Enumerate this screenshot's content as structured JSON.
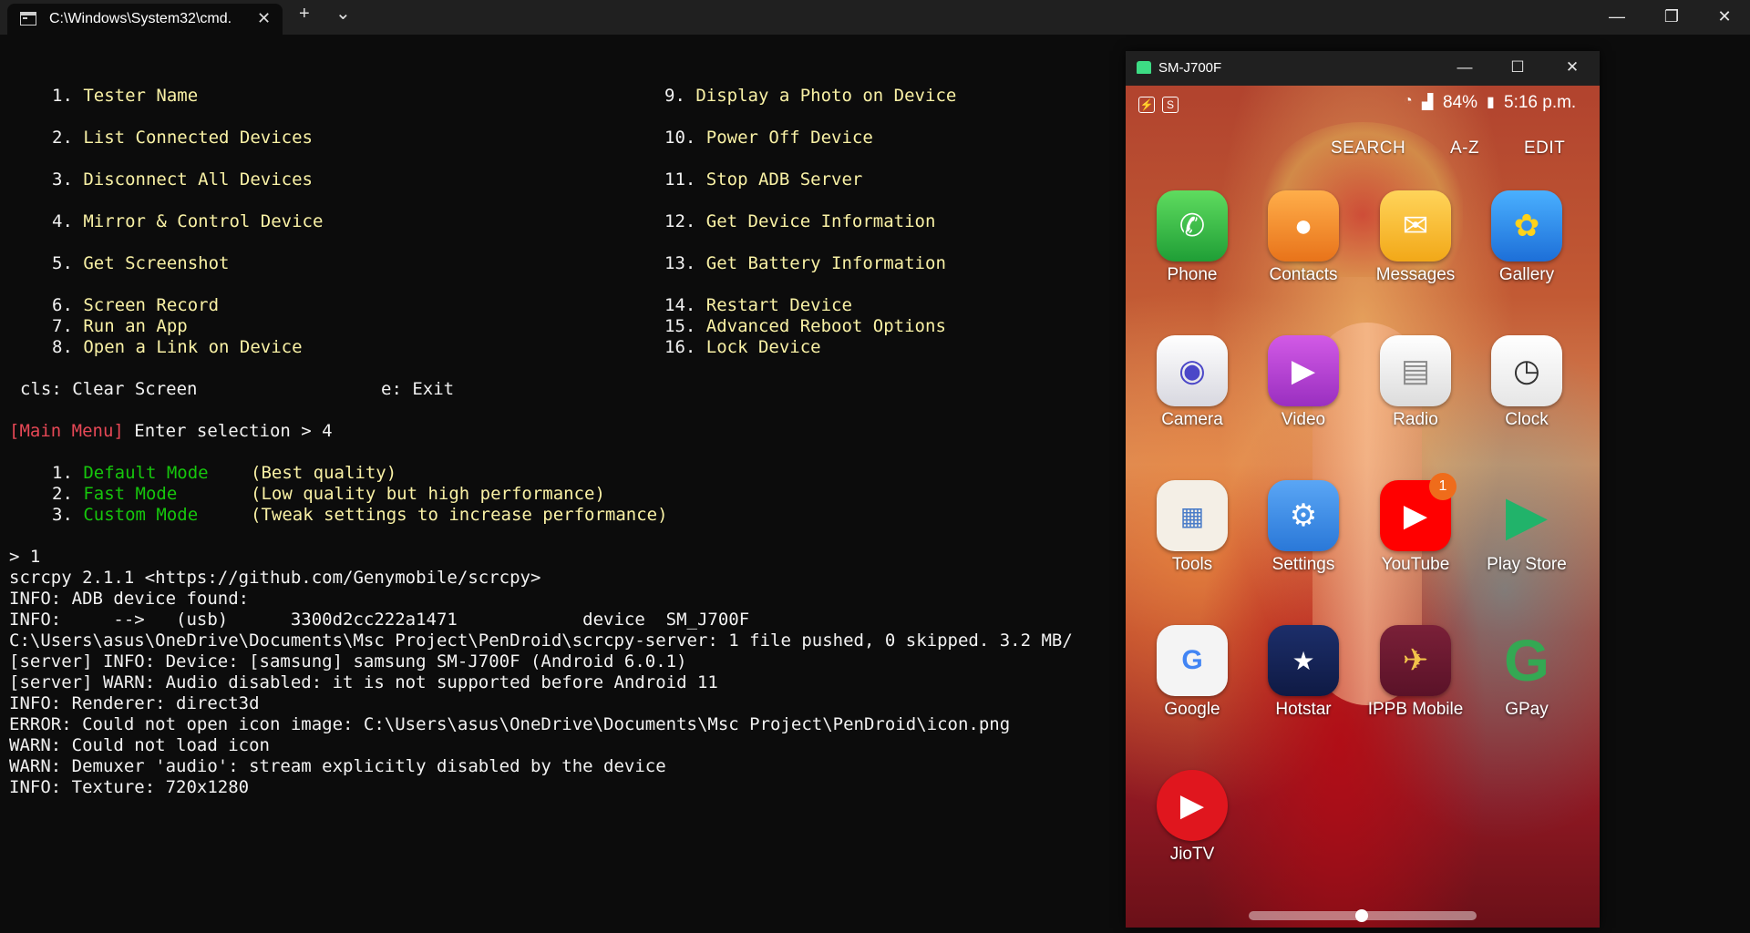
{
  "titlebar": {
    "tab_title": "C:\\Windows\\System32\\cmd.",
    "tab_close": "✕",
    "new_tab": "+",
    "dropdown": "⌄",
    "minimize": "—",
    "maximize": "❐",
    "close": "✕"
  },
  "menu": {
    "left": [
      {
        "num": "1.",
        "label": "Tester Name"
      },
      {
        "num": "2.",
        "label": "List Connected Devices"
      },
      {
        "num": "3.",
        "label": "Disconnect All Devices"
      },
      {
        "num": "4.",
        "label": "Mirror & Control Device"
      },
      {
        "num": "5.",
        "label": "Get Screenshot"
      },
      {
        "num": "6.",
        "label": "Screen Record"
      },
      {
        "num": "7.",
        "label": "Run an App"
      },
      {
        "num": "8.",
        "label": "Open a Link on Device"
      }
    ],
    "right": [
      {
        "num": "9.",
        "label": "Display a Photo on Device"
      },
      {
        "num": "10.",
        "label": "Power Off Device"
      },
      {
        "num": "11.",
        "label": "Stop ADB Server"
      },
      {
        "num": "12.",
        "label": "Get Device Information"
      },
      {
        "num": "13.",
        "label": "Get Battery Information"
      },
      {
        "num": "14.",
        "label": "Restart Device"
      },
      {
        "num": "15.",
        "label": "Advanced Reboot Options"
      },
      {
        "num": "16.",
        "label": "Lock Device"
      }
    ],
    "cls": "cls: Clear Screen",
    "exit": "e: Exit"
  },
  "prompt": {
    "tag": "[Main Menu]",
    "text": " Enter selection > 4"
  },
  "modes": [
    {
      "num": "1.",
      "name": "Default Mode",
      "desc": "(Best quality)"
    },
    {
      "num": "2.",
      "name": "Fast Mode",
      "desc": "(Low quality but high performance)"
    },
    {
      "num": "3.",
      "name": "Custom Mode",
      "desc": "(Tweak settings to increase performance)"
    }
  ],
  "output": [
    "> 1",
    "scrcpy 2.1.1 <https://github.com/Genymobile/scrcpy>",
    "INFO: ADB device found:",
    "INFO:     -->   (usb)      3300d2cc222a1471            device  SM_J700F",
    "C:\\Users\\asus\\OneDrive\\Documents\\Msc Project\\PenDroid\\scrcpy-server: 1 file pushed, 0 skipped. 3.2 MB/",
    "[server] INFO: Device: [samsung] samsung SM-J700F (Android 6.0.1)",
    "[server] WARN: Audio disabled: it is not supported before Android 11",
    "INFO: Renderer: direct3d",
    "ERROR: Could not open icon image: C:\\Users\\asus\\OneDrive\\Documents\\Msc Project\\PenDroid\\icon.png",
    "WARN: Could not load icon",
    "WARN: Demuxer 'audio': stream explicitly disabled by the device",
    "INFO: Texture: 720x1280"
  ],
  "mirror": {
    "title": "SM-J700F",
    "minimize": "—",
    "maximize": "☐",
    "close": "✕",
    "status": {
      "battery": "84%",
      "time": "5:16 p.m."
    },
    "top_actions": [
      "SEARCH",
      "A-Z",
      "EDIT"
    ],
    "apps": [
      {
        "label": "Phone",
        "icon": "phone-icon",
        "color": "#2fb84a",
        "glyph": "✆"
      },
      {
        "label": "Contacts",
        "icon": "contacts-icon",
        "color": "#f38a1e",
        "glyph": "👤"
      },
      {
        "label": "Messages",
        "icon": "messages-icon",
        "color": "#f5b31c",
        "glyph": "✉"
      },
      {
        "label": "Gallery",
        "icon": "gallery-icon",
        "color": "#2c8ee8",
        "glyph": "✿"
      },
      {
        "label": "Camera",
        "icon": "camera-icon",
        "color": "#e8e8ee",
        "glyph": "◉"
      },
      {
        "label": "Video",
        "icon": "video-icon",
        "color": "#b53ccf",
        "glyph": "▶"
      },
      {
        "label": "Radio",
        "icon": "radio-icon",
        "color": "#e9e9e9",
        "glyph": "▤"
      },
      {
        "label": "Clock",
        "icon": "clock-icon",
        "color": "#f2f2f2",
        "glyph": "◷"
      },
      {
        "label": "Tools",
        "icon": "tools-folder-icon",
        "color": "#f4efe6",
        "glyph": "▦"
      },
      {
        "label": "Settings",
        "icon": "settings-icon",
        "color": "#3a8ee6",
        "glyph": "⚙"
      },
      {
        "label": "YouTube",
        "icon": "youtube-icon",
        "color": "#ff0000",
        "glyph": "▶",
        "badge": "1"
      },
      {
        "label": "Play Store",
        "icon": "play-store-icon",
        "color": "transparent",
        "glyph": "▶"
      },
      {
        "label": "Google",
        "icon": "google-folder-icon",
        "color": "#f4f4f4",
        "glyph": "G"
      },
      {
        "label": "Hotstar",
        "icon": "hotstar-icon",
        "color": "#1a2a5e",
        "glyph": "★"
      },
      {
        "label": "IPPB Mobile",
        "icon": "ippb-icon",
        "color": "#6b1a2e",
        "glyph": "✈"
      },
      {
        "label": "GPay",
        "icon": "gpay-icon",
        "color": "transparent",
        "glyph": "G"
      },
      {
        "label": "JioTV",
        "icon": "jiotv-icon",
        "color": "#e0161e",
        "glyph": "▶"
      }
    ]
  }
}
